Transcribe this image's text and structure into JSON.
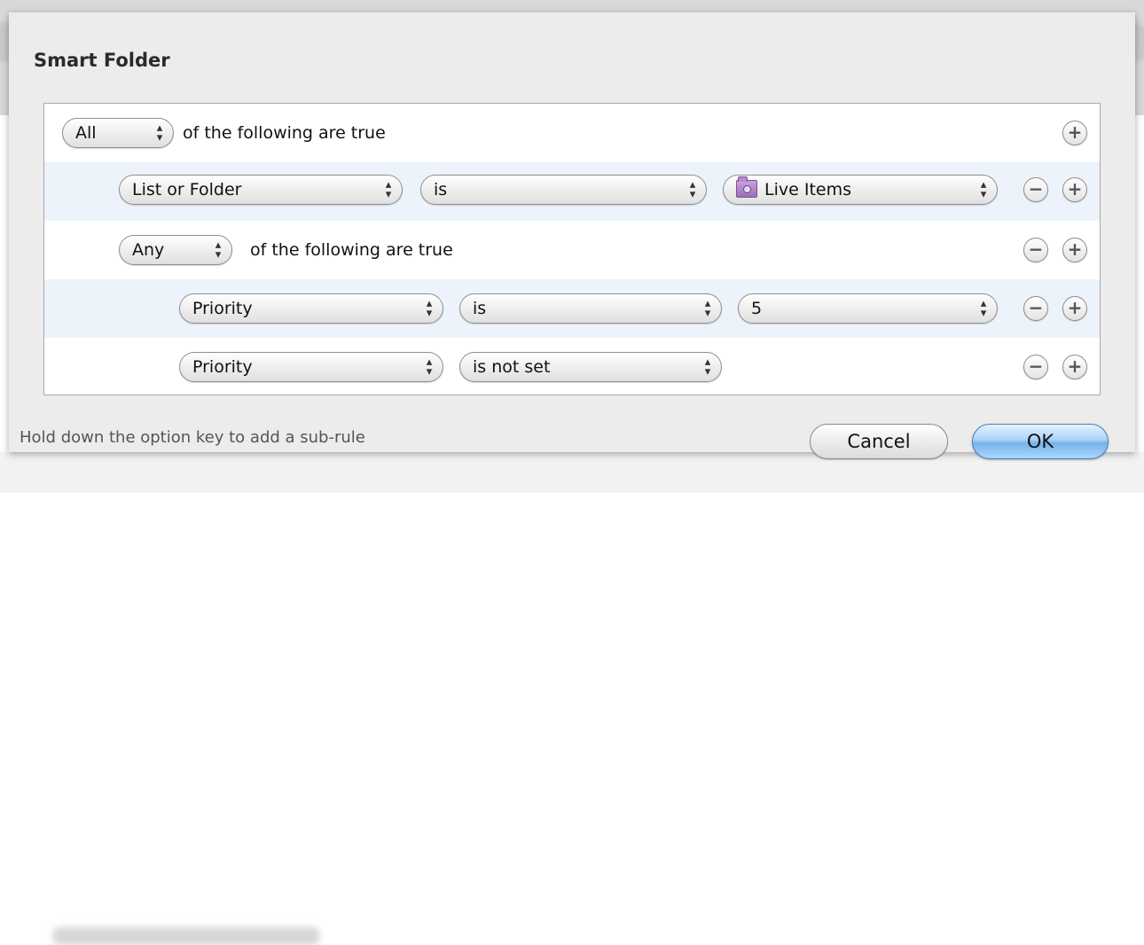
{
  "dialog": {
    "title": "Smart Folder",
    "hint": "Hold down the option key to add a sub-rule",
    "cancel_label": "Cancel",
    "ok_label": "OK"
  },
  "icons": {
    "add": "+",
    "remove": "−",
    "popup_arrows": "⬍"
  },
  "rules": [
    {
      "type": "group",
      "match": "All",
      "text": "of the following are true"
    },
    {
      "type": "condition",
      "field": "List or Folder",
      "operator": "is",
      "value": "Live Items",
      "value_icon": "smart-folder-icon"
    },
    {
      "type": "group",
      "match": "Any",
      "text": "of the following are true"
    },
    {
      "type": "condition",
      "field": "Priority",
      "operator": "is",
      "value": "5"
    },
    {
      "type": "condition",
      "field": "Priority",
      "operator": "is not set"
    }
  ],
  "colors": {
    "ok_button": "#77b2ea",
    "alt_row": "#edf3fb",
    "folder_icon": "#9b6fb8"
  }
}
